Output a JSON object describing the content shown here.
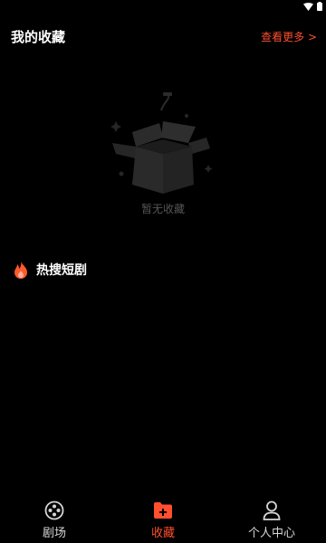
{
  "header": {
    "title": "我的收藏",
    "view_more": "查看更多 >"
  },
  "empty_state": {
    "text": "暂无收藏",
    "icon": "empty-box-icon"
  },
  "hot_section": {
    "title": "热搜短剧",
    "icon": "fire-icon"
  },
  "tabbar": {
    "tabs": [
      {
        "label": "剧场",
        "icon": "film-reel-icon",
        "active": false
      },
      {
        "label": "收藏",
        "icon": "folder-add-icon",
        "active": true
      },
      {
        "label": "个人中心",
        "icon": "person-icon",
        "active": false
      }
    ]
  },
  "colors": {
    "background": "#000000",
    "accent": "#ff4f2e",
    "text_primary": "#ffffff",
    "text_muted": "#555555"
  }
}
